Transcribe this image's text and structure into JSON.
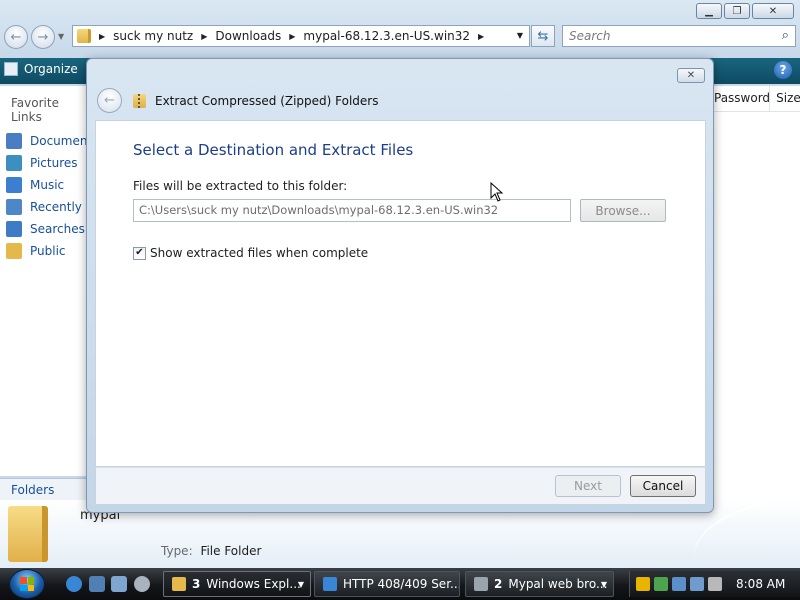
{
  "explorer": {
    "breadcrumbs": [
      "suck my nutz",
      "Downloads",
      "mypal-68.12.3.en-US.win32"
    ],
    "search_placeholder": "Search",
    "toolbar": {
      "organize_label": "Organize",
      "help_label": "?"
    },
    "left_pane": {
      "title": "Favorite Links",
      "items": [
        {
          "label": "Documents",
          "icon": "documents-icon",
          "color": "#4a7ec4"
        },
        {
          "label": "Pictures",
          "icon": "pictures-icon",
          "color": "#3c8fbf"
        },
        {
          "label": "Music",
          "icon": "music-icon",
          "color": "#3a7fd0"
        },
        {
          "label": "Recently Changed",
          "icon": "recent-icon",
          "color": "#4f86c8"
        },
        {
          "label": "Searches",
          "icon": "searches-icon",
          "color": "#3e7cc6"
        },
        {
          "label": "Public",
          "icon": "public-folder-icon",
          "color": "#e5b84c"
        }
      ],
      "folders_label": "Folders"
    },
    "columns": [
      "Password ...",
      "Size"
    ],
    "details": {
      "name": "mypal",
      "type_label": "Type:",
      "type_value": "File Folder"
    }
  },
  "dialog": {
    "title": "Extract Compressed (Zipped) Folders",
    "heading": "Select a Destination and Extract Files",
    "destination_label": "Files will be extracted to this folder:",
    "destination_path": "C:\\Users\\suck my nutz\\Downloads\\mypal-68.12.3.en-US.win32",
    "browse_label": "Browse...",
    "show_files_label": "Show extracted files when complete",
    "show_files_checked": true,
    "next_label": "Next",
    "next_enabled": false,
    "cancel_label": "Cancel"
  },
  "taskbar": {
    "buttons": [
      {
        "count": "3",
        "label": "Windows Expl...",
        "icon": "folder-icon",
        "color": "#e5b84c",
        "active": true
      },
      {
        "count": "",
        "label": "HTTP 408/409 Ser...",
        "icon": "ie-icon",
        "color": "#3a86d6",
        "active": false
      },
      {
        "count": "2",
        "label": "Mypal web bro...",
        "icon": "mypal-icon",
        "color": "#9aa4ad",
        "active": false
      }
    ],
    "clock": "8:08 AM"
  }
}
